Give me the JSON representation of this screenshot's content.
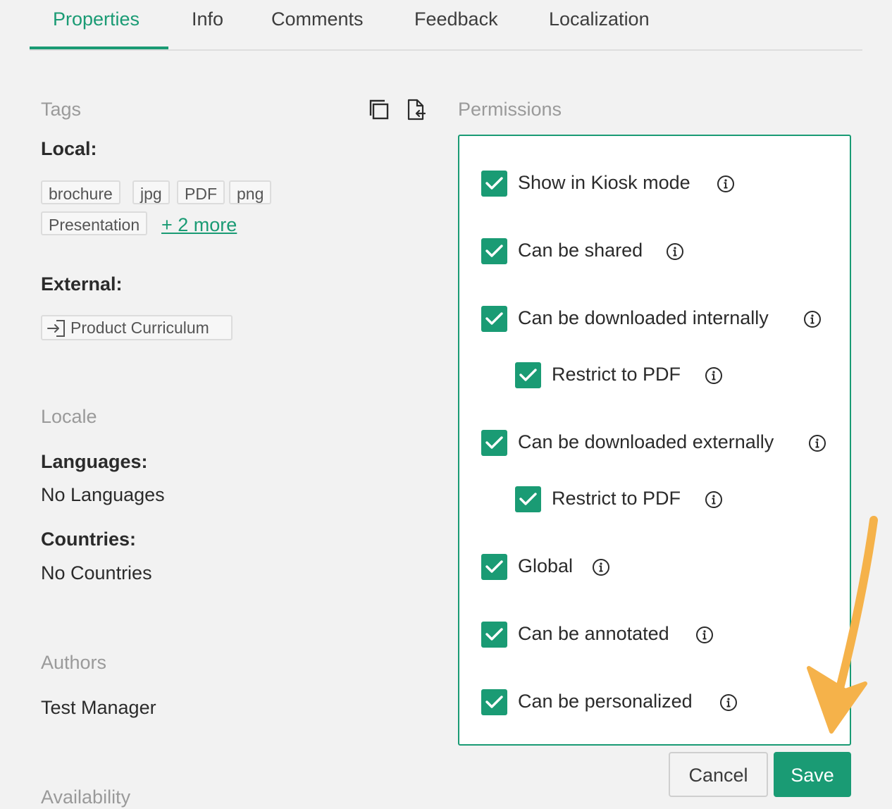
{
  "tabs": [
    {
      "label": "Properties",
      "active": true
    },
    {
      "label": "Info"
    },
    {
      "label": "Comments"
    },
    {
      "label": "Feedback"
    },
    {
      "label": "Localization"
    }
  ],
  "tags": {
    "title": "Tags",
    "local_label": "Local:",
    "local_tags": [
      "brochure",
      "jpg",
      "PDF",
      "png",
      "Presentation"
    ],
    "more_link": "+ 2 more",
    "external_label": "External:",
    "external_tags": [
      "Product Curriculum"
    ]
  },
  "locale": {
    "title": "Locale",
    "languages_label": "Languages:",
    "languages_value": "No Languages",
    "countries_label": "Countries:",
    "countries_value": "No Countries"
  },
  "authors": {
    "title": "Authors",
    "value": "Test Manager"
  },
  "availability": {
    "title": "Availability"
  },
  "permissions": {
    "title": "Permissions",
    "items": [
      {
        "label": "Show in Kiosk mode",
        "checked": true
      },
      {
        "label": "Can be shared",
        "checked": true
      },
      {
        "label": "Can be downloaded internally",
        "checked": true
      },
      {
        "label": "Restrict to PDF",
        "checked": true
      },
      {
        "label": "Can be downloaded externally",
        "checked": true
      },
      {
        "label": "Restrict to PDF",
        "checked": true
      },
      {
        "label": "Global",
        "checked": true
      },
      {
        "label": "Can be annotated",
        "checked": true
      },
      {
        "label": "Can be personalized",
        "checked": true
      }
    ]
  },
  "actions": {
    "cancel": "Cancel",
    "save": "Save"
  },
  "colors": {
    "accent": "#1a9b74",
    "arrow": "#f5b24a"
  },
  "icons": {
    "copy": "copy-icon",
    "paste": "paste-icon",
    "external": "external-link-icon",
    "info": "info-icon",
    "check": "check-icon",
    "arrow": "annotation-arrow-icon"
  }
}
